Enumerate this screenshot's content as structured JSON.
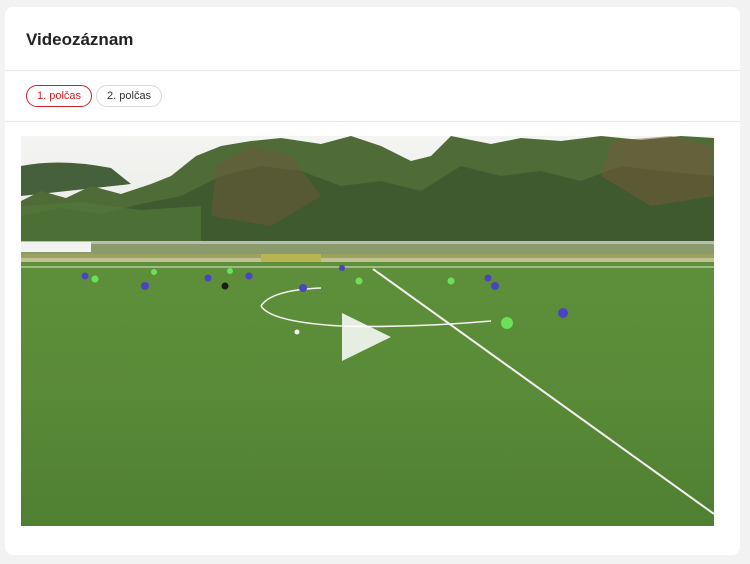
{
  "section": {
    "title": "Videozáznam"
  },
  "tabs": [
    {
      "label": "1. polčas",
      "active": true
    },
    {
      "label": "2. polčas",
      "active": false
    }
  ],
  "video": {
    "play_icon": "play-icon",
    "accent_color": "#d0202b"
  }
}
